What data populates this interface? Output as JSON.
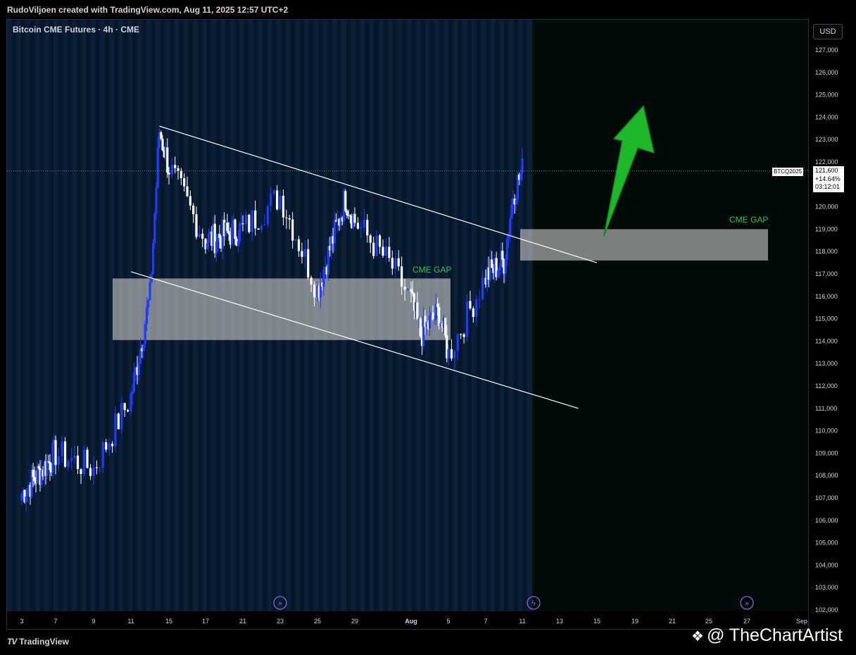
{
  "header": {
    "text": "RudoViljoen created with TradingView.com, Aug 11, 2025 12:57 UTC+2"
  },
  "symbol_label": "Bitcoin CME Futures · 4h · CME",
  "currency_button": "USD",
  "price_tag": {
    "symbol": "BTCQ2025",
    "price": "121,600",
    "change": "+14.64%",
    "countdown": "03:12:01"
  },
  "annotations": {
    "gap_lower": "CME GAP",
    "gap_upper": "CME GAP"
  },
  "footer": {
    "logo": "TradingView",
    "logo_mark": "TV",
    "watermark": "@ TheChartArtist"
  },
  "chart_data": {
    "type": "candlestick",
    "title": "",
    "y_ticks": [
      "127,000",
      "126,000",
      "125,000",
      "124,000",
      "123,000",
      "122,000",
      "121,000",
      "120,000",
      "119,000",
      "118,000",
      "117,000",
      "116,000",
      "115,000",
      "114,000",
      "113,000",
      "112,000",
      "111,000",
      "110,000",
      "109,000",
      "108,000",
      "107,000",
      "106,000",
      "105,000",
      "104,000",
      "103,000",
      "102,000"
    ],
    "ylim": [
      101800,
      127700
    ],
    "x_ticks": [
      "3",
      "7",
      "9",
      "11",
      "15",
      "17",
      "21",
      "23",
      "25",
      "29",
      "Aug",
      "5",
      "7",
      "11",
      "13",
      "15",
      "19",
      "21",
      "25",
      "27",
      "Sep"
    ],
    "key_closes": [
      {
        "x": "Jul 3",
        "y": 107200
      },
      {
        "x": "Jul 7",
        "y": 109000
      },
      {
        "x": "Jul 9",
        "y": 108300
      },
      {
        "x": "Jul 11",
        "y": 111500
      },
      {
        "x": "Jul 13",
        "y": 116000
      },
      {
        "x": "Jul 14",
        "y": 123400
      },
      {
        "x": "Jul 17",
        "y": 118500
      },
      {
        "x": "Jul 21",
        "y": 119000
      },
      {
        "x": "Jul 23",
        "y": 120500
      },
      {
        "x": "Jul 25",
        "y": 116300
      },
      {
        "x": "Jul 28",
        "y": 120400
      },
      {
        "x": "Jul 31",
        "y": 117300
      },
      {
        "x": "Aug 2",
        "y": 114300
      },
      {
        "x": "Aug 4",
        "y": 115300
      },
      {
        "x": "Aug 5",
        "y": 113400
      },
      {
        "x": "Aug 7",
        "y": 116900
      },
      {
        "x": "Aug 9",
        "y": 117600
      },
      {
        "x": "Aug 10",
        "y": 120600
      },
      {
        "x": "Aug 11",
        "y": 121600
      }
    ],
    "last_price": 121600,
    "gaps": [
      {
        "label": "CME GAP",
        "from": 114050,
        "to": 116800
      },
      {
        "label": "CME GAP",
        "from": 117600,
        "to": 119000
      }
    ],
    "channel": {
      "upper": [
        {
          "x": "Jul 14",
          "y": 123600
        },
        {
          "x": "Aug 15",
          "y": 117500
        }
      ],
      "lower": [
        {
          "x": "Jul 11",
          "y": 117100
        },
        {
          "x": "Aug 14",
          "y": 111000
        }
      ]
    },
    "arrow": {
      "from": 118700,
      "to": 124500
    }
  }
}
